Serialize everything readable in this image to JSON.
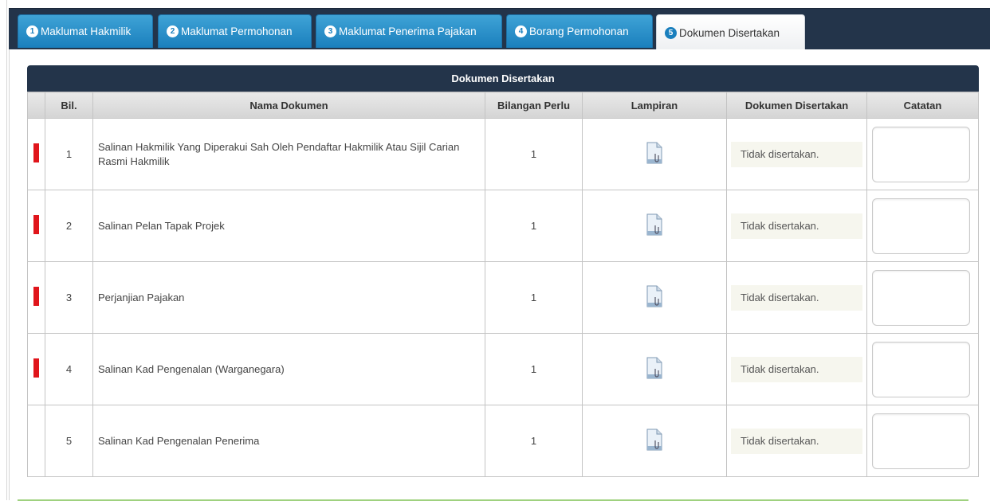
{
  "tabs": [
    {
      "num": "1",
      "label": "Maklumat Hakmilik",
      "active": false
    },
    {
      "num": "2",
      "label": "Maklumat Permohonan",
      "active": false
    },
    {
      "num": "3",
      "label": "Maklumat Penerima Pajakan",
      "active": false
    },
    {
      "num": "4",
      "label": "Borang Permohonan",
      "active": false
    },
    {
      "num": "5",
      "label": "Dokumen Disertakan",
      "active": true
    }
  ],
  "table": {
    "caption": "Dokumen Disertakan",
    "headers": {
      "bil": "Bil.",
      "nama": "Nama Dokumen",
      "bilangan": "Bilangan Perlu",
      "lampiran": "Lampiran",
      "disertakan": "Dokumen Disertakan",
      "catatan": "Catatan"
    },
    "rows": [
      {
        "required": true,
        "bil": "1",
        "nama": "Salinan Hakmilik Yang Diperakui Sah Oleh Pendaftar Hakmilik Atau Sijil Carian Rasmi Hakmilik",
        "bilangan": "1",
        "status": "Tidak disertakan.",
        "catatan": ""
      },
      {
        "required": true,
        "bil": "2",
        "nama": "Salinan Pelan Tapak Projek",
        "bilangan": "1",
        "status": "Tidak disertakan.",
        "catatan": ""
      },
      {
        "required": true,
        "bil": "3",
        "nama": "Perjanjian Pajakan",
        "bilangan": "1",
        "status": "Tidak disertakan.",
        "catatan": ""
      },
      {
        "required": true,
        "bil": "4",
        "nama": "Salinan Kad Pengenalan (Warganegara)",
        "bilangan": "1",
        "status": "Tidak disertakan.",
        "catatan": ""
      },
      {
        "required": false,
        "bil": "5",
        "nama": "Salinan Kad Pengenalan Penerima",
        "bilangan": "1",
        "status": "Tidak disertakan.",
        "catatan": ""
      }
    ]
  },
  "icons": {
    "attachment": "file-attachment-icon"
  },
  "colors": {
    "header_bg": "#23344a",
    "tab_bg": "#1a7fbd",
    "required_mark": "#e0151b"
  }
}
